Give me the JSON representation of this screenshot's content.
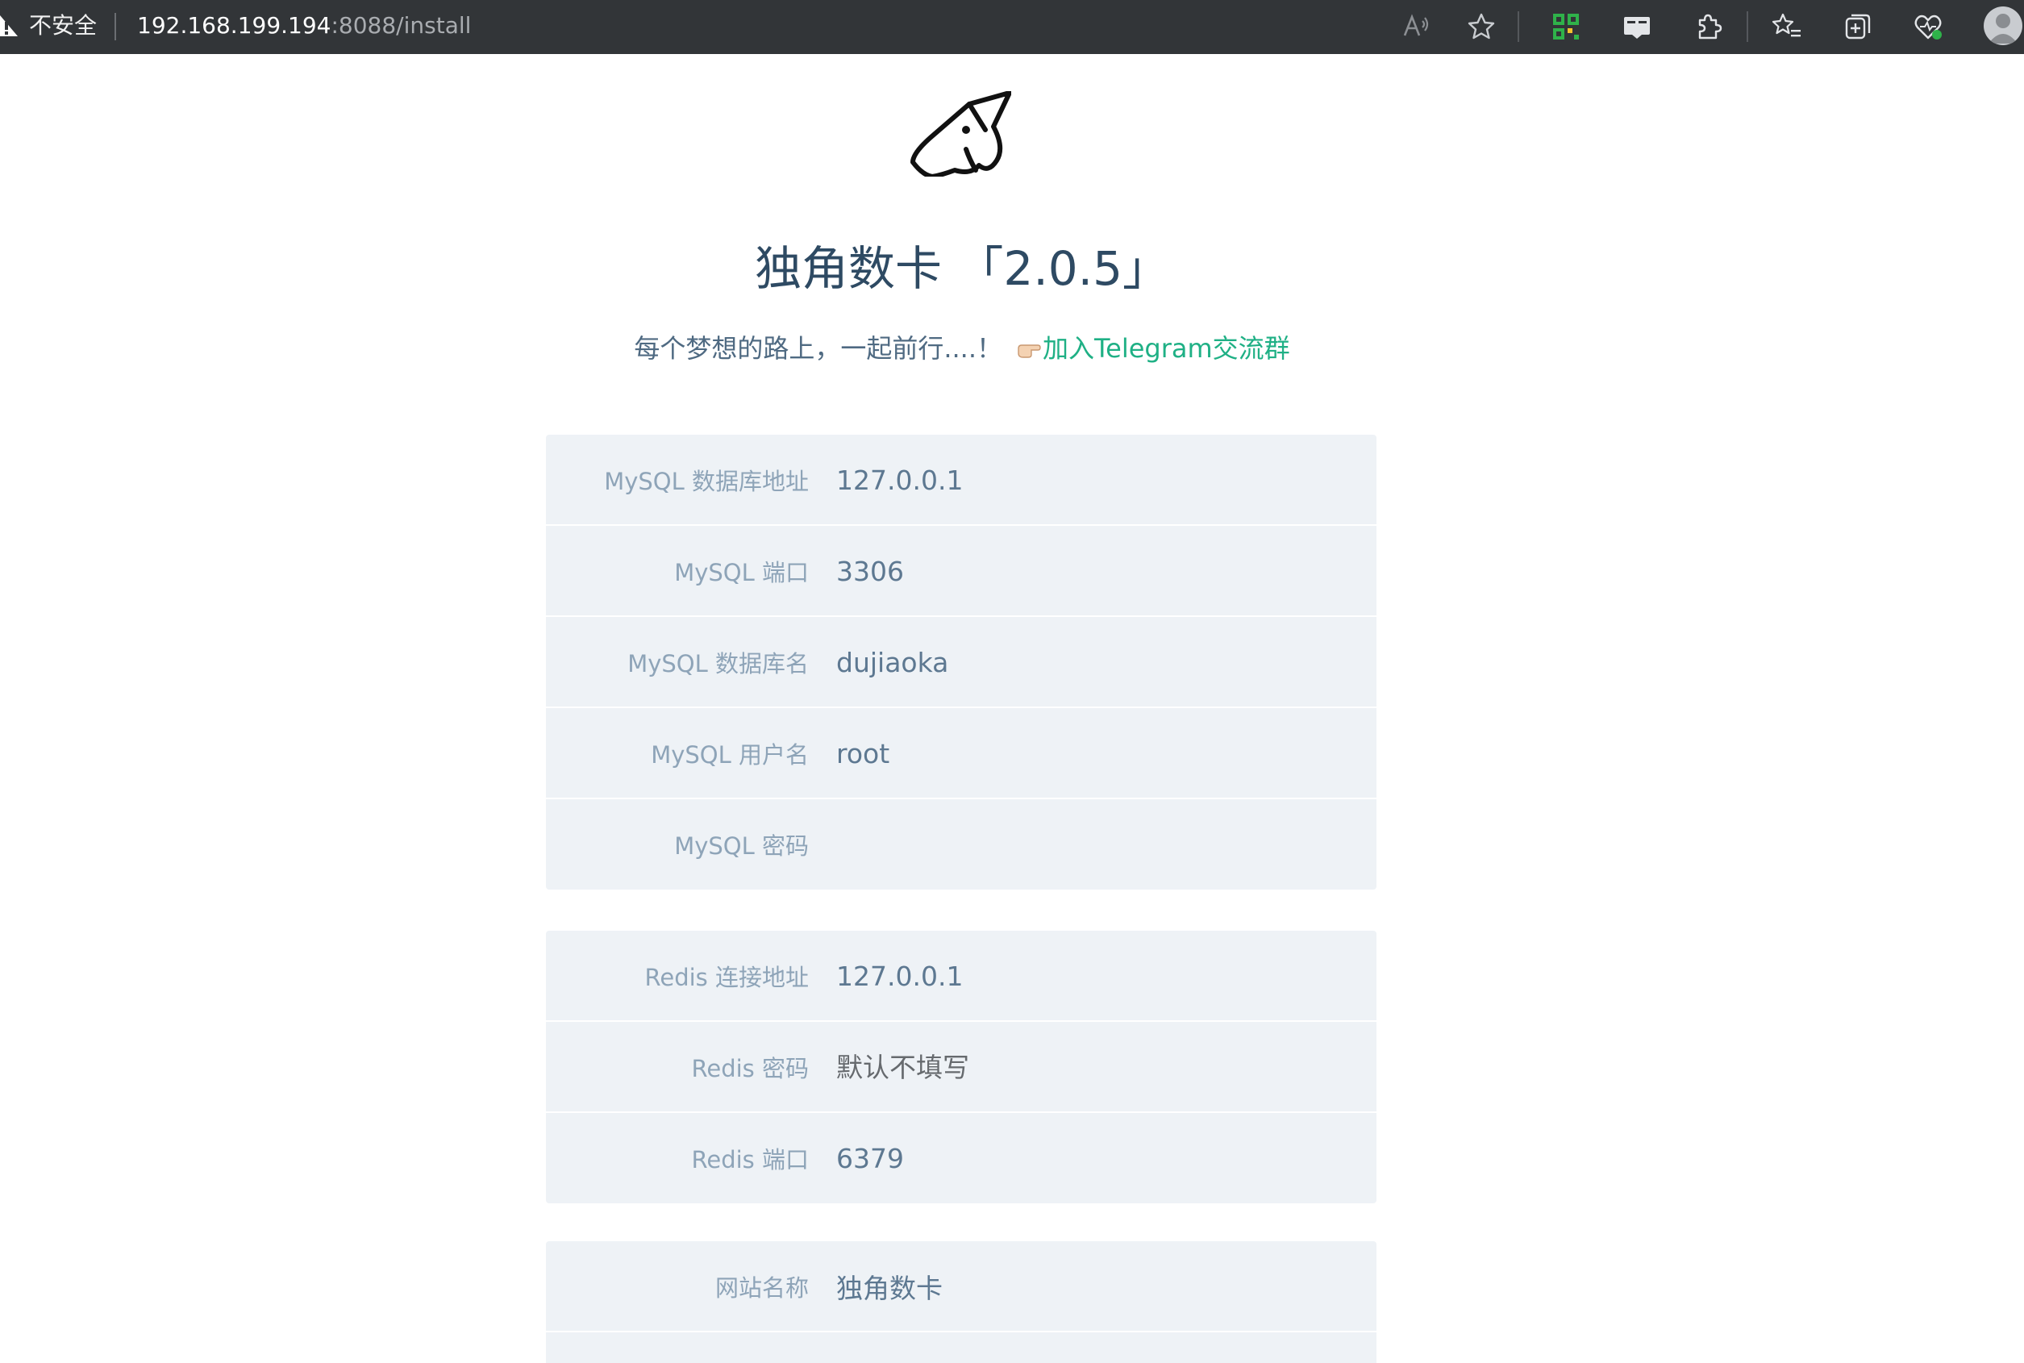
{
  "browser": {
    "security_label": "不安全",
    "url_host": "192.168.199.194",
    "url_path": ":8088/install",
    "accent": "#323538"
  },
  "header": {
    "title": "独角数卡 「2.0.5」",
    "subtitle": "每个梦想的路上，一起前行....！",
    "telegram_link": "加入Telegram交流群"
  },
  "mysql": {
    "host_label": "MySQL 数据库地址",
    "host_value": "127.0.0.1",
    "port_label": "MySQL 端口",
    "port_value": "3306",
    "db_label": "MySQL 数据库名",
    "db_value": "dujiaoka",
    "user_label": "MySQL 用户名",
    "user_value": "root",
    "password_label": "MySQL 密码",
    "password_value": ""
  },
  "redis": {
    "host_label": "Redis 连接地址",
    "host_value": "127.0.0.1",
    "password_label": "Redis 密码",
    "password_placeholder": "默认不填写",
    "port_label": "Redis 端口",
    "port_value": "6379"
  },
  "site": {
    "name_label": "网站名称",
    "name_value": "独角数卡"
  },
  "colors": {
    "card_bg": "#eef2f6",
    "label": "#8ea4b8",
    "value": "#5d7891",
    "title": "#2e4a63",
    "link": "#1fb085"
  }
}
